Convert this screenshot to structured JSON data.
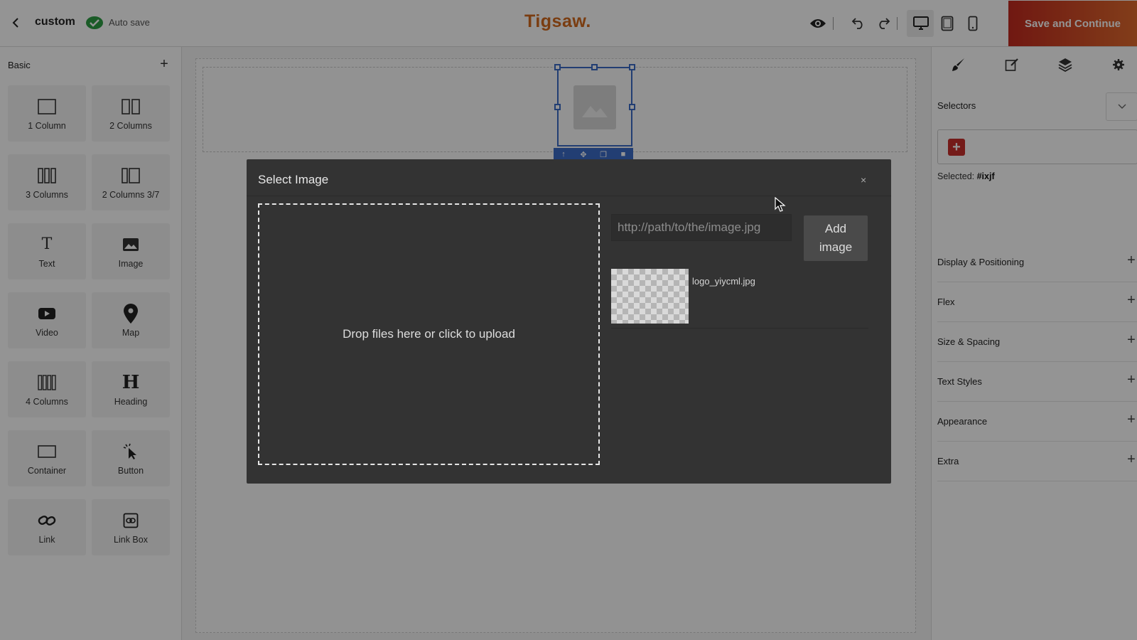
{
  "header": {
    "project_name": "custom",
    "autosave_label": "Auto save",
    "brand": "Tigsaw.",
    "save_button": "Save and Continue",
    "icons": [
      "back-arrow-icon",
      "check-circle-icon",
      "eye-icon",
      "undo-icon",
      "redo-icon",
      "desktop-icon",
      "tablet-icon",
      "mobile-icon"
    ],
    "brand_color": "#d2691e",
    "accent_gradient": [
      "#c22a1f",
      "#e06a2d"
    ]
  },
  "blocks_panel": {
    "category": "Basic",
    "items": [
      {
        "label": "1 Column",
        "icon": "one-column-icon"
      },
      {
        "label": "2 Columns",
        "icon": "two-columns-icon"
      },
      {
        "label": "3 Columns",
        "icon": "three-columns-icon"
      },
      {
        "label": "2 Columns 3/7",
        "icon": "two-columns-3-7-icon"
      },
      {
        "label": "Text",
        "icon": "text-icon"
      },
      {
        "label": "Image",
        "icon": "image-icon"
      },
      {
        "label": "Video",
        "icon": "video-icon"
      },
      {
        "label": "Map",
        "icon": "map-pin-icon"
      },
      {
        "label": "4 Columns",
        "icon": "four-columns-icon"
      },
      {
        "label": "Heading",
        "icon": "heading-icon"
      },
      {
        "label": "Container",
        "icon": "container-icon"
      },
      {
        "label": "Button",
        "icon": "pointer-click-icon"
      },
      {
        "label": "Link",
        "icon": "link-icon"
      },
      {
        "label": "Link Box",
        "icon": "link-box-icon"
      }
    ]
  },
  "style_panel": {
    "tabs": [
      "brush-icon",
      "edit-icon",
      "layers-icon",
      "gear-icon"
    ],
    "selectors_label": "Selectors",
    "selected_prefix": "Selected:",
    "selected_id": "#ixjf",
    "sectors": [
      "Display & Positioning",
      "Flex",
      "Size & Spacing",
      "Text Styles",
      "Appearance",
      "Extra"
    ]
  },
  "modal": {
    "title": "Select Image",
    "close": "×",
    "dropzone_text": "Drop files here or click to upload",
    "url_placeholder": "http://path/to/the/image.jpg",
    "add_button": "Add image",
    "assets": [
      {
        "name": "logo_yiycml.jpg"
      }
    ]
  }
}
